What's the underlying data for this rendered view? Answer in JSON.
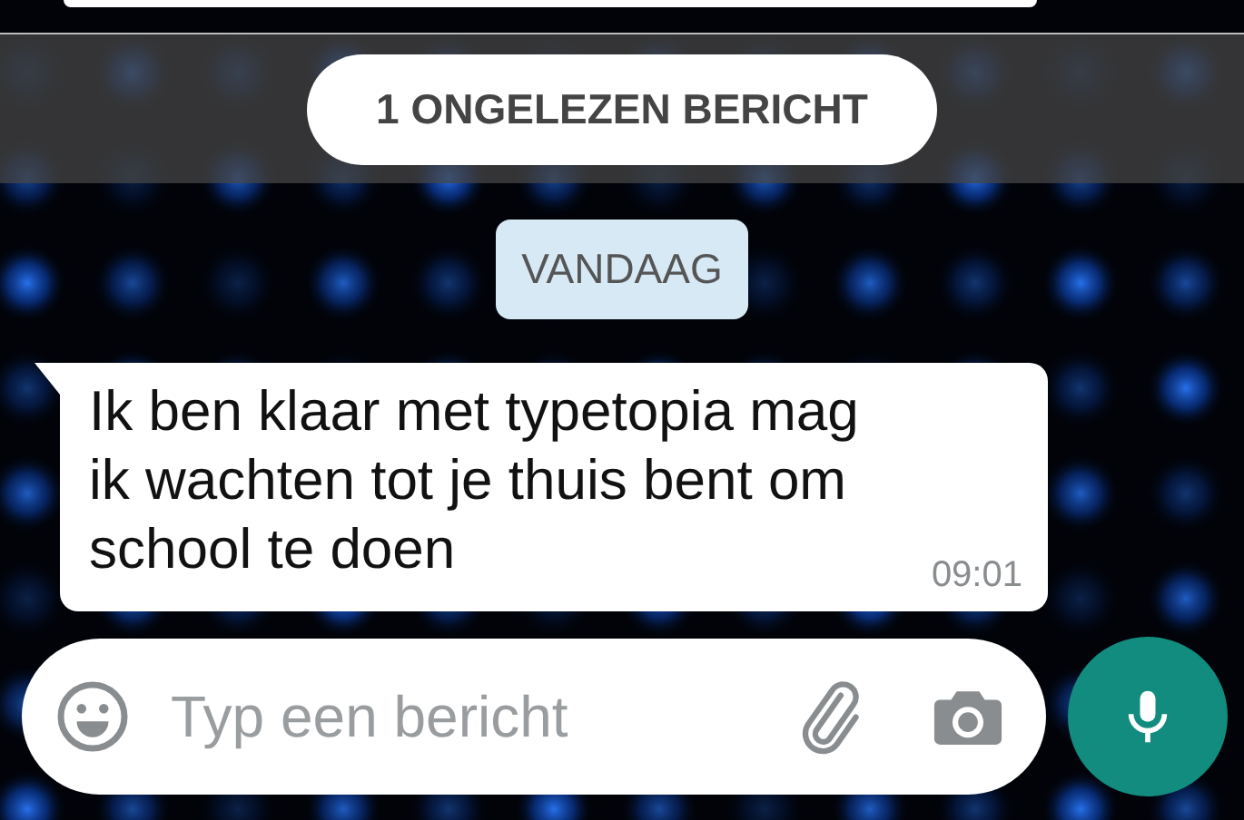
{
  "unread_banner": {
    "text": "1 ONGELEZEN BERICHT"
  },
  "date_chip": {
    "text": "VANDAAG"
  },
  "messages": [
    {
      "text": "Ik ben klaar met typetopia mag ik wachten tot je thuis bent om school te doen",
      "time": "09:01"
    }
  ],
  "composer": {
    "placeholder": "Typ een bericht"
  }
}
